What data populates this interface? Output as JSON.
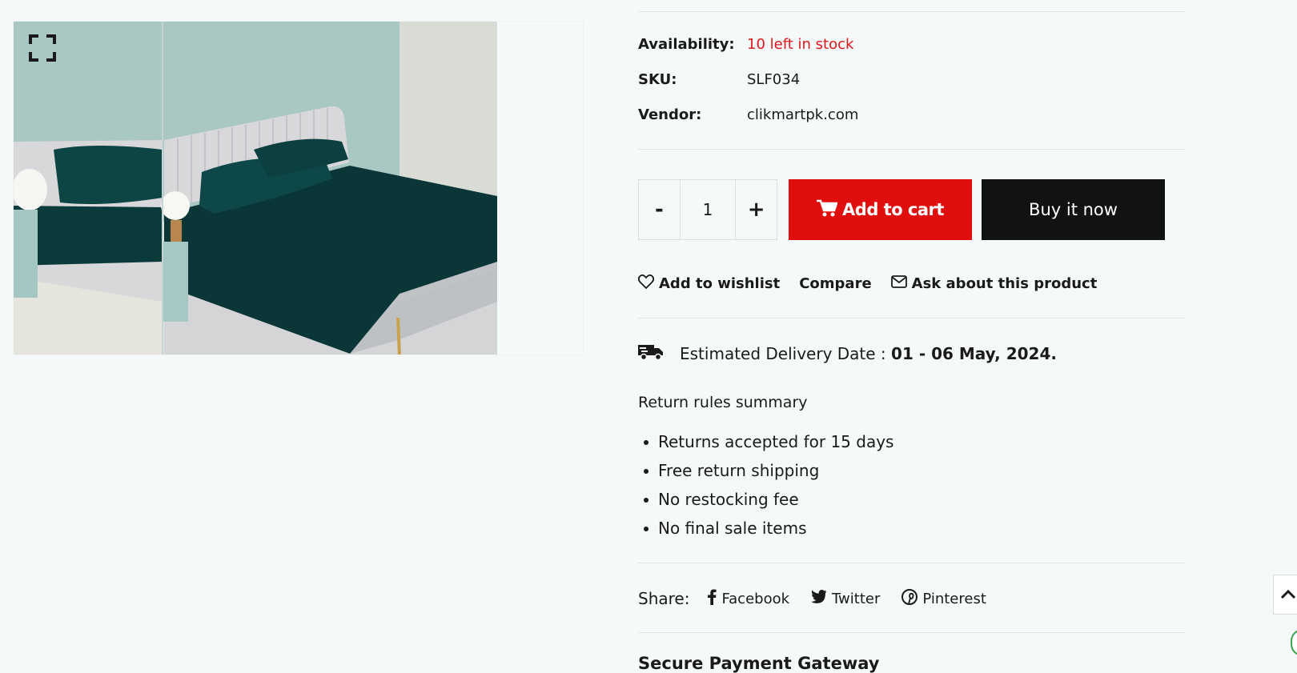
{
  "gallery": {
    "expand_icon": "expand-icon",
    "image_alt": "Bed with dark green satin sheets and grey tufted headboard"
  },
  "product": {
    "availability_label": "Availability:",
    "availability_value": "10 left in stock",
    "sku_label": "SKU:",
    "sku_value": "SLF034",
    "vendor_label": "Vendor:",
    "vendor_value": "clikmartpk.com"
  },
  "purchase": {
    "decrement_label": "-",
    "quantity": "1",
    "increment_label": "+",
    "add_to_cart_label": "Add to cart",
    "cart_icon": "cart-icon",
    "buy_now_label": "Buy it now"
  },
  "actions": {
    "wishlist_label": "Add to wishlist",
    "wishlist_icon": "heart-icon",
    "compare_label": "Compare",
    "ask_label": "Ask about this product",
    "ask_icon": "envelope-icon"
  },
  "delivery": {
    "icon": "truck-icon",
    "label": "Estimated Delivery Date :",
    "date": "01 - 06 May, 2024."
  },
  "returns": {
    "title": "Return rules summary",
    "items": [
      "Returns accepted for 15 days",
      "Free return shipping",
      "No restocking fee",
      "No final sale items"
    ]
  },
  "share": {
    "label": "Share:",
    "links": [
      {
        "label": "Facebook",
        "icon": "facebook-icon"
      },
      {
        "label": "Twitter",
        "icon": "twitter-icon"
      },
      {
        "label": "Pinterest",
        "icon": "pinterest-icon"
      }
    ]
  },
  "secure": {
    "title": "Secure Payment Gateway"
  },
  "colors": {
    "page_bg": "#f5f9fa",
    "stock_red": "#e0171a",
    "add_to_cart_bg": "#e10e0e",
    "buy_now_bg": "#111214",
    "sheet_green": "#0b3a3a",
    "wall_blue": "#a9c7c3"
  }
}
